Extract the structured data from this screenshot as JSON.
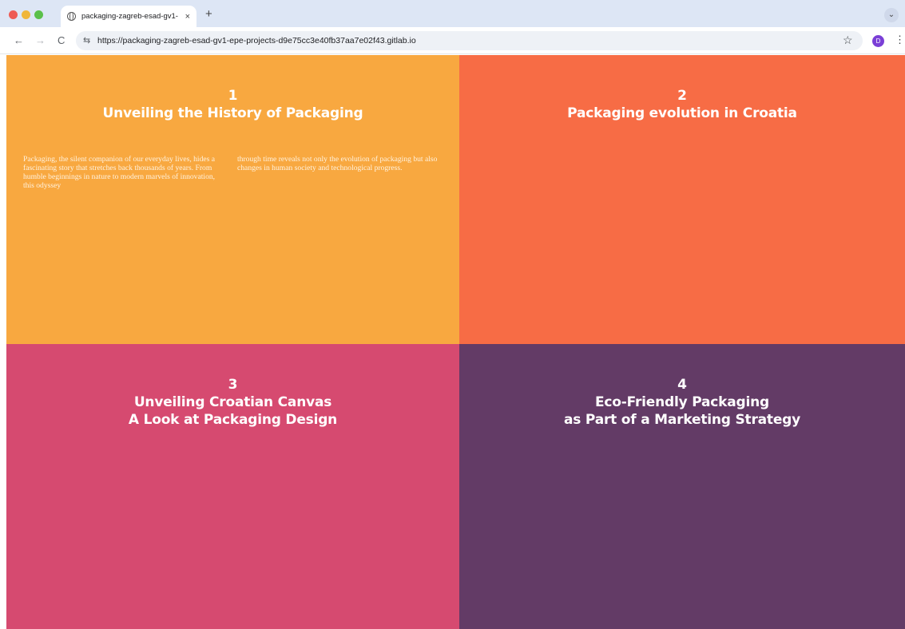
{
  "browser": {
    "tab_title": "packaging-zagreb-esad-gv1-",
    "tab_close": "×",
    "new_tab": "+",
    "tab_menu": "⌄",
    "url": "https://packaging-zagreb-esad-gv1-epe-projects-d9e75cc3e40fb37aa7e02f43.gitlab.io",
    "profile_initial": "D",
    "icons": {
      "back": "←",
      "forward": "→",
      "reload": "C",
      "site_settings": "⇆",
      "bookmark": "☆",
      "menu": "⋮"
    }
  },
  "sections": [
    {
      "number": "1",
      "title_lines": [
        "Unveiling the History of Packaging"
      ],
      "color": "#f8a840",
      "intro_columns": [
        "Packaging, the silent companion of our everyday lives, hides a fascinating story that stretches back thousands of years. From humble beginnings in nature to modern marvels of innovation, this odyssey",
        "through time reveals not only the evolution of packaging but also changes in human society and technological progress."
      ]
    },
    {
      "number": "2",
      "title_lines": [
        "Packaging evolution in Croatia"
      ],
      "color": "#f76c45"
    },
    {
      "number": "3",
      "title_lines": [
        "Unveiling Croatian Canvas",
        "A Look at Packaging Design"
      ],
      "color": "#d64a70"
    },
    {
      "number": "4",
      "title_lines": [
        "Eco-Friendly Packaging",
        "as Part of a Marketing Strategy"
      ],
      "color": "#633b66"
    }
  ]
}
